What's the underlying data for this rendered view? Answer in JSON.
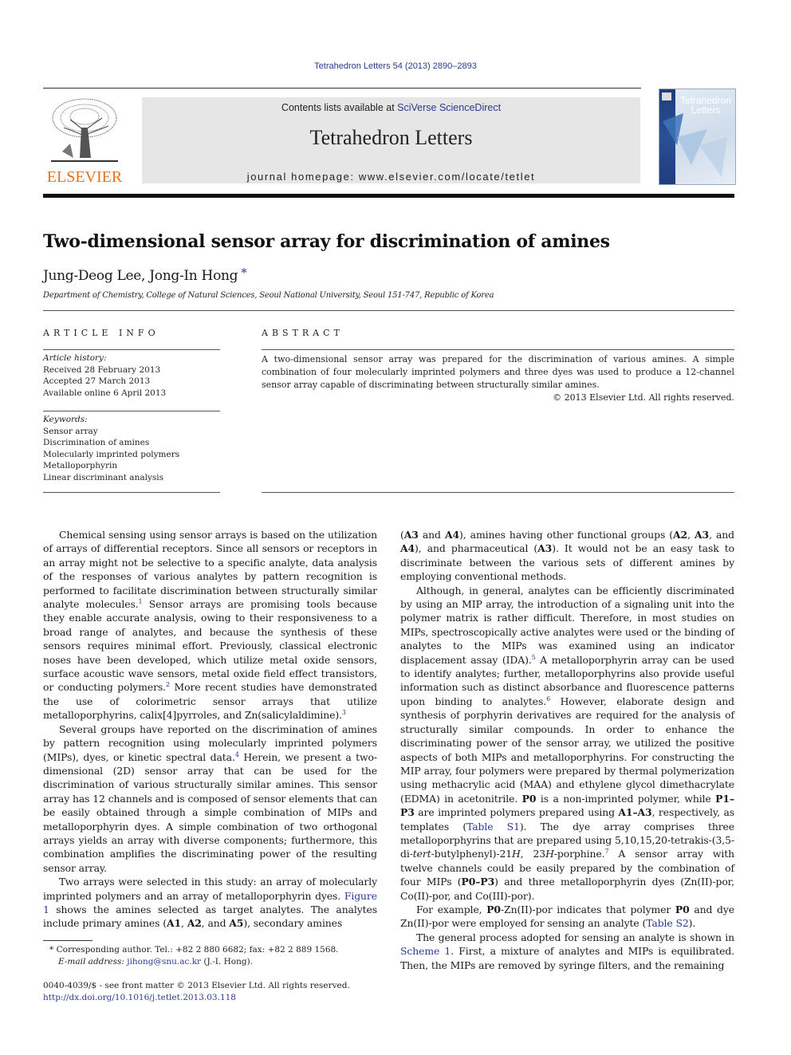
{
  "header": {
    "journal_ref": "Tetrahedron Letters 54 (2013) 2890–2893",
    "contents_prefix": "Contents lists available at ",
    "contents_link": "SciVerse ScienceDirect",
    "journal_title": "Tetrahedron Letters",
    "homepage": "journal homepage: www.elsevier.com/locate/tetlet",
    "publisher_logo": "ELSEVIER",
    "cover_title_1": "Tetrahedron",
    "cover_title_2": "Letters"
  },
  "article": {
    "title": "Two-dimensional sensor array for discrimination of amines",
    "authors": "Jung-Deog Lee, Jong-In Hong",
    "author_mark": "*",
    "affiliation": "Department of Chemistry, College of Natural Sciences, Seoul National University, Seoul 151-747, Republic of Korea"
  },
  "article_info": {
    "heading": "ARTICLE INFO",
    "history_label": "Article history:",
    "history": [
      "Received 28 February 2013",
      "Accepted 27 March 2013",
      "Available online 6 April 2013"
    ],
    "keywords_label": "Keywords:",
    "keywords": [
      "Sensor array",
      "Discrimination of amines",
      "Molecularly imprinted polymers",
      "Metalloporphyrin",
      "Linear discriminant analysis"
    ]
  },
  "abstract": {
    "heading": "ABSTRACT",
    "text": "A two-dimensional sensor array was prepared for the discrimination of various amines. A simple combination of four molecularly imprinted polymers and three dyes was used to produce a 12-channel sensor array capable of discriminating between structurally similar amines.",
    "copyright": "© 2013 Elsevier Ltd. All rights reserved."
  },
  "body": {
    "left": {
      "p1": [
        "Chemical sensing using sensor arrays is based on the utilization of arrays of differential receptors. Since all sensors or receptors in an array might not be selective to a specific analyte, data analysis of the responses of various analytes by pattern recognition is performed to facilitate discrimination between structurally similar analyte molecules.",
        "1",
        " Sensor arrays are promising tools because they enable accurate analysis, owing to their responsiveness to a broad range of analytes, and because the synthesis of these sensors requires minimal effort. Previously, classical electronic noses have been developed, which utilize metal oxide sensors, surface acoustic wave sensors, metal oxide field effect transistors, or conducting polymers.",
        "2",
        " More recent studies have demonstrated the use of colorimetric sensor arrays that utilize metalloporphyrins, calix[4]pyrroles, and Zn(salicylaldimine).",
        "3"
      ],
      "p2": [
        "Several groups have reported on the discrimination of amines by pattern recognition using molecularly imprinted polymers (MIPs), dyes, or kinetic spectral data.",
        "4",
        " Herein, we present a two-dimensional (2D) sensor array that can be used for the discrimination of various structurally similar amines. This sensor array has 12 channels and is composed of sensor elements that can be easily obtained through a simple combination of MIPs and metalloporphyrin dyes. A simple combination of two orthogonal arrays yields an array with diverse components; furthermore, this combination amplifies the discriminating power of the resulting sensor array."
      ],
      "p3": [
        "Two arrays were selected in this study: an array of molecularly imprinted polymers and an array of metalloporphyrin dyes. ",
        "Figure 1",
        " shows the amines selected as target analytes. The analytes include primary amines (",
        "A1",
        ", ",
        "A2",
        ", and ",
        "A5",
        "), secondary amines"
      ]
    },
    "right": {
      "p1": [
        "(",
        "A3",
        " and ",
        "A4",
        "), amines having other functional groups (",
        "A2",
        ", ",
        "A3",
        ", and ",
        "A4",
        "), and pharmaceutical (",
        "A3",
        "). It would not be an easy task to discriminate between the various sets of different amines by employing conventional methods."
      ],
      "p2": [
        "Although, in general, analytes can be efficiently discriminated by using an MIP array, the introduction of a signaling unit into the polymer matrix is rather difficult. Therefore, in most studies on MIPs, spectroscopically active analytes were used or the binding of analytes to the MIPs was examined using an indicator displacement assay (IDA).",
        "5",
        " A metalloporphyrin array can be used to identify analytes; further, metalloporphyrins also provide useful information such as distinct absorbance and fluorescence patterns upon binding to analytes.",
        "6",
        " However, elaborate design and synthesis of porphyrin derivatives are required for the analysis of structurally similar compounds. In order to enhance the discriminating power of the sensor array, we utilized the positive aspects of both MIPs and metalloporphyrins. For constructing the MIP array, four polymers were prepared by thermal polymerization using methacrylic acid (MAA) and ethylene glycol dimethacrylate (EDMA) in acetonitrile. ",
        "P0",
        " is a non-imprinted polymer, while ",
        "P1–P3",
        " are imprinted polymers prepared using ",
        "A1–A3",
        ", respectively, as templates (",
        "Table S1",
        "). The dye array comprises three metalloporphyrins that are prepared using 5,10,15,20-tetrakis-(3,5-di-",
        "tert",
        "-butylphenyl)-21",
        "H",
        ", 23",
        "H",
        "-porphine.",
        "7",
        " A sensor array with twelve channels could be easily prepared by the combination of four MIPs (",
        "P0–P3",
        ") and three metalloporphyrin dyes (Zn(II)-por, Co(II)-por, and Co(III)-por)."
      ],
      "p3": [
        "For example, ",
        "P0",
        "-Zn(II)-por indicates that polymer ",
        "P0",
        " and dye Zn(II)-por were employed for sensing an analyte (",
        "Table S2",
        ")."
      ],
      "p4": [
        "The general process adopted for sensing an analyte is shown in ",
        "Scheme 1",
        ". First, a mixture of analytes and MIPs is equilibrated. Then, the MIPs are removed by syringe filters, and the remaining"
      ]
    }
  },
  "footnotes": {
    "star": "*",
    "corresponding": " Corresponding author. Tel.: +82 2 880 6682; fax: +82 2 889 1568.",
    "email_label": "E-mail address:",
    "email": "jihong@snu.ac.kr",
    "email_suffix": " (J.-I. Hong).",
    "frontmatter": "0040-4039/$ - see front matter © 2013 Elsevier Ltd. All rights reserved.",
    "doi": "http://dx.doi.org/10.1016/j.tetlet.2013.03.118"
  }
}
